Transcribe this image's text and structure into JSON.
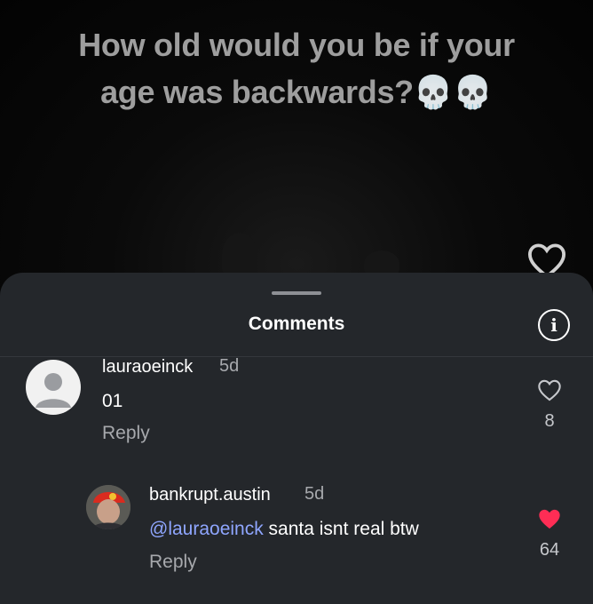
{
  "video": {
    "title": "How old would you be if your age was backwards?💀💀"
  },
  "sheet": {
    "title": "Comments"
  },
  "comments": [
    {
      "username": "lauraoeinck",
      "time": "5d",
      "text": "01",
      "reply_label": "Reply",
      "likes": "8",
      "liked": false,
      "avatar_icon": "default-avatar-icon"
    },
    {
      "username": "bankrupt.austin",
      "time": "5d",
      "mention": "@lauraoeinck",
      "text": " santa isnt real btw",
      "reply_label": "Reply",
      "likes": "64",
      "liked": true,
      "avatar_icon": "user-photo-avatar"
    }
  ],
  "colors": {
    "sheet_bg": "#24272b",
    "mention": "#8fa6ff",
    "liked_heart": "#ff2d55"
  }
}
